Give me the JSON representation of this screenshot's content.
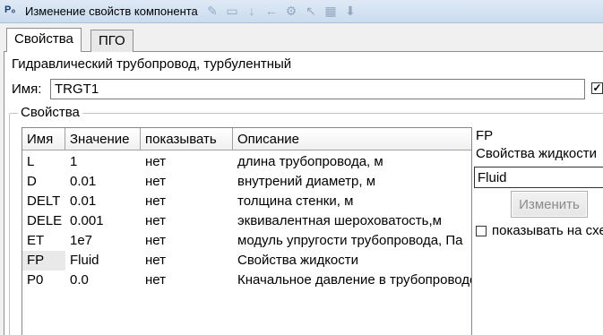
{
  "window": {
    "icon_text": "P₀",
    "title": "Изменение свойств компонента"
  },
  "tabs": [
    {
      "label": "Свойства",
      "active": true
    },
    {
      "label": "ПГО",
      "active": false
    }
  ],
  "component": {
    "type": "Гидравлический трубопровод, турбулентный",
    "name_label": "Имя:",
    "name_value": "TRGT1",
    "name_checkbox_checked": true
  },
  "properties": {
    "group_title": "Свойства",
    "columns": [
      "Имя",
      "Значение",
      "показывать",
      "Описание"
    ],
    "rows": [
      [
        "L",
        "1",
        "нет",
        "длина трубопровода, м"
      ],
      [
        "D",
        "0.01",
        "нет",
        "внутрений диаметр,  м"
      ],
      [
        "DELT",
        "0.01",
        "нет",
        "толщина стенки,     м"
      ],
      [
        "DELE",
        "0.001",
        "нет",
        "эквивалентная шероховатость,м"
      ],
      [
        "ET",
        "1e7",
        "нет",
        "модуль упругости трубопровода,  Па"
      ],
      [
        "FP",
        "Fluid",
        "нет",
        "Свойства жидкости"
      ],
      [
        "P0",
        "0.0",
        "нет",
        "Кначальное давление в трубопроводе"
      ]
    ],
    "selected_row": 5
  },
  "detail": {
    "name": "FP",
    "description": "Свойства жидкости",
    "value": "Fluid",
    "button_label": "Изменить",
    "show_label": "показывать на схеме",
    "show_checked": false
  }
}
